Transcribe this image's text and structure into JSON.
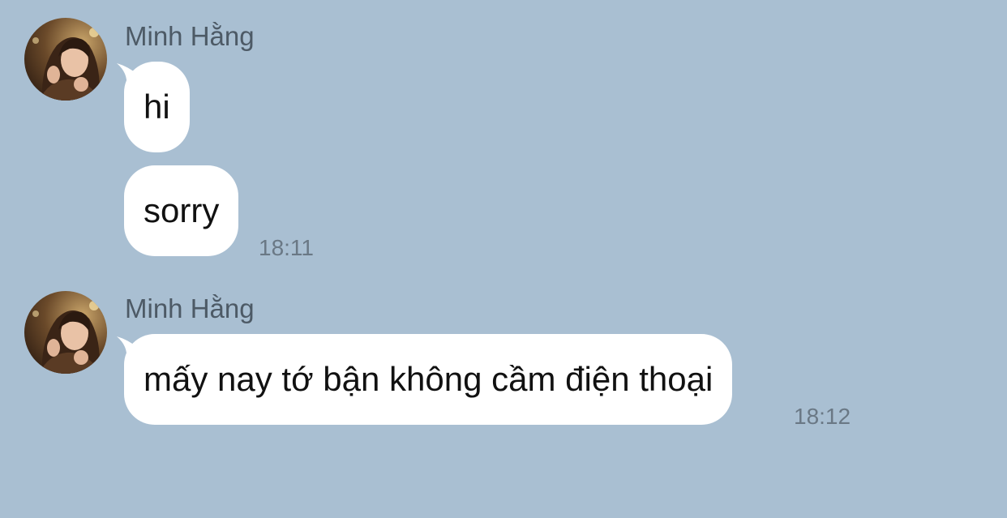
{
  "chat": {
    "groups": [
      {
        "sender": "Minh Hằng",
        "messages": [
          {
            "text": "hi",
            "time": ""
          },
          {
            "text": "sorry",
            "time": "18:11"
          }
        ]
      },
      {
        "sender": "Minh Hằng",
        "messages": [
          {
            "text": "mấy nay tớ bận không cầm điện thoại",
            "time": "18:12"
          }
        ]
      }
    ]
  },
  "colors": {
    "background": "#a9bfd2",
    "bubble": "#ffffff",
    "sender_text": "#4d5a66",
    "timestamp_text": "#6a7885"
  },
  "icons": {
    "avatar": "profile-photo"
  }
}
